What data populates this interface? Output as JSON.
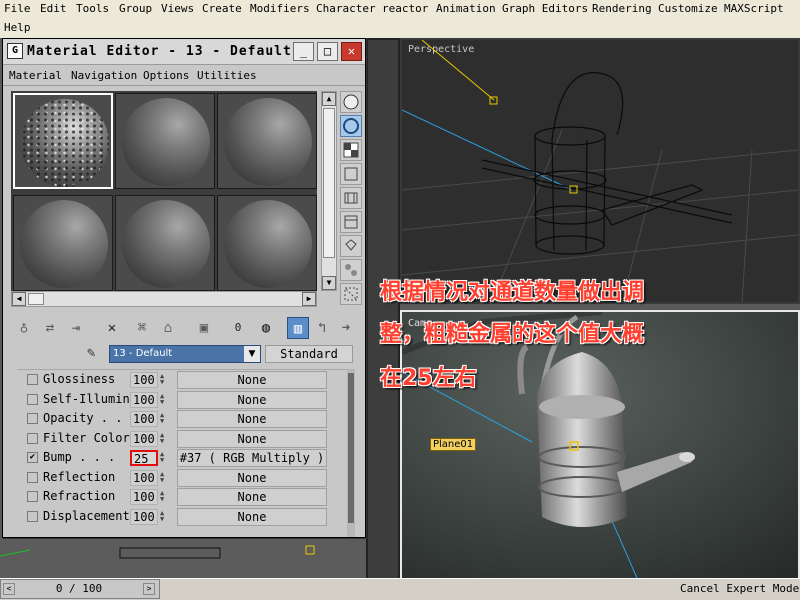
{
  "main_menu": {
    "items": [
      "File",
      "Edit",
      "Tools",
      "Group",
      "Views",
      "Create",
      "Modifiers",
      "Character",
      "reactor",
      "Animation",
      "Graph Editors",
      "Rendering",
      "Customize",
      "MAXScript"
    ],
    "help": "Help"
  },
  "material_editor": {
    "title": "Material Editor - 13 - Default",
    "menu": [
      "Material",
      "Navigation",
      "Options",
      "Utilities"
    ],
    "material_name": "13 - Default",
    "material_type": "Standard",
    "slot_count": 6,
    "bottom_toolbar_value": "0",
    "params": [
      {
        "label": "Glossiness",
        "amount": "100",
        "map": "None",
        "checked": false,
        "highlight": false
      },
      {
        "label": "Self-Illumin",
        "amount": "100",
        "map": "None",
        "checked": false,
        "highlight": false
      },
      {
        "label": "Opacity . .",
        "amount": "100",
        "map": "None",
        "checked": false,
        "highlight": false
      },
      {
        "label": "Filter Color",
        "amount": "100",
        "map": "None",
        "checked": false,
        "highlight": false
      },
      {
        "label": "Bump  . . .",
        "amount": "25",
        "map": "#37  ( RGB Multiply )",
        "checked": true,
        "highlight": true
      },
      {
        "label": "Reflection",
        "amount": "100",
        "map": "None",
        "checked": false,
        "highlight": false
      },
      {
        "label": "Refraction",
        "amount": "100",
        "map": "None",
        "checked": false,
        "highlight": false
      },
      {
        "label": "Displacement",
        "amount": "100",
        "map": "None",
        "checked": false,
        "highlight": false
      }
    ]
  },
  "viewports": {
    "perspective_label": "Perspective",
    "camera_label": "Came",
    "plane_label": "Plane01"
  },
  "timeline": {
    "frame": "0 / 100"
  },
  "status": {
    "text": "Cancel Expert Mode"
  },
  "annotation": [
    "根据情况对通道数量做出调",
    "整，粗糙金属的这个值大概",
    "在25左右"
  ]
}
